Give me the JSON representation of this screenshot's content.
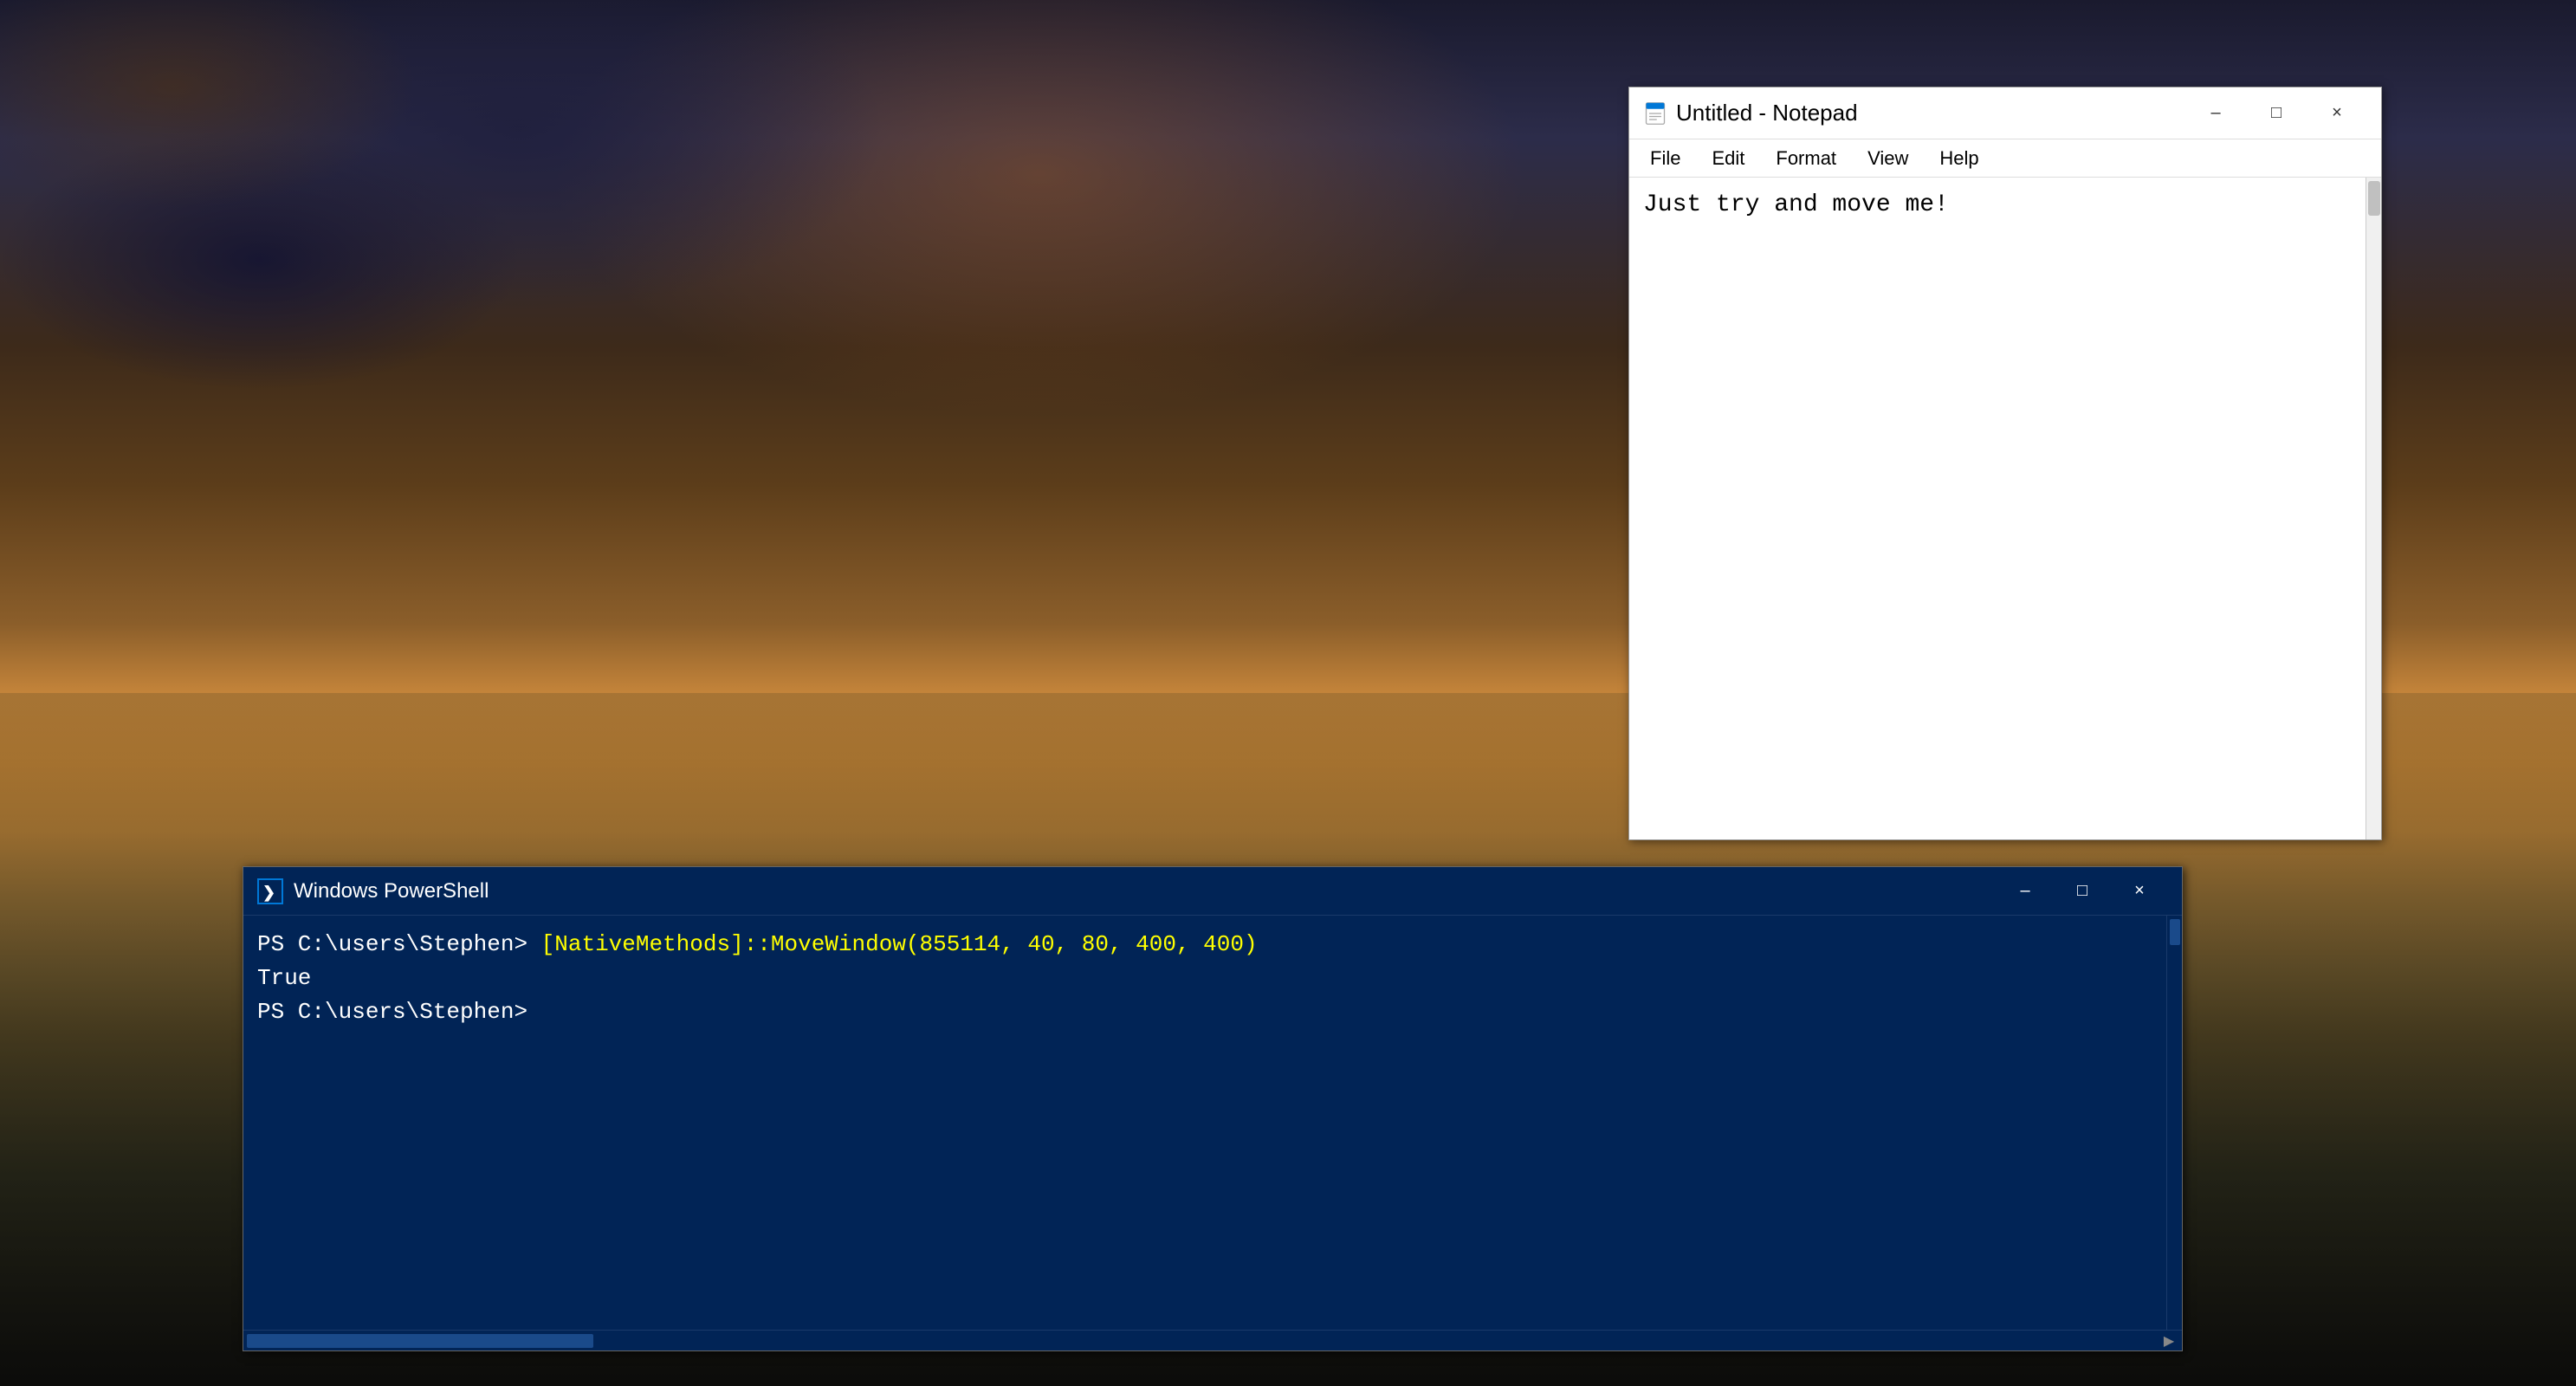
{
  "desktop": {
    "background_description": "Sunset over ocean with dramatic clouds"
  },
  "notepad": {
    "title": "Untitled - Notepad",
    "icon_label": "notepad-icon",
    "menu": {
      "file": "File",
      "edit": "Edit",
      "format": "Format",
      "view": "View",
      "help": "Help"
    },
    "content": "Just try and move me!",
    "controls": {
      "minimize": "–",
      "maximize": "□",
      "close": "×"
    }
  },
  "powershell": {
    "title": "Windows PowerShell",
    "icon_label": "powershell-icon",
    "lines": [
      "PS C:\\users\\Stephen> [NativeMethods]::MoveWindow(855114, 40, 80, 400, 400)",
      "True",
      "PS C:\\users\\Stephen> "
    ],
    "controls": {
      "minimize": "–",
      "maximize": "□",
      "close": "×"
    }
  }
}
